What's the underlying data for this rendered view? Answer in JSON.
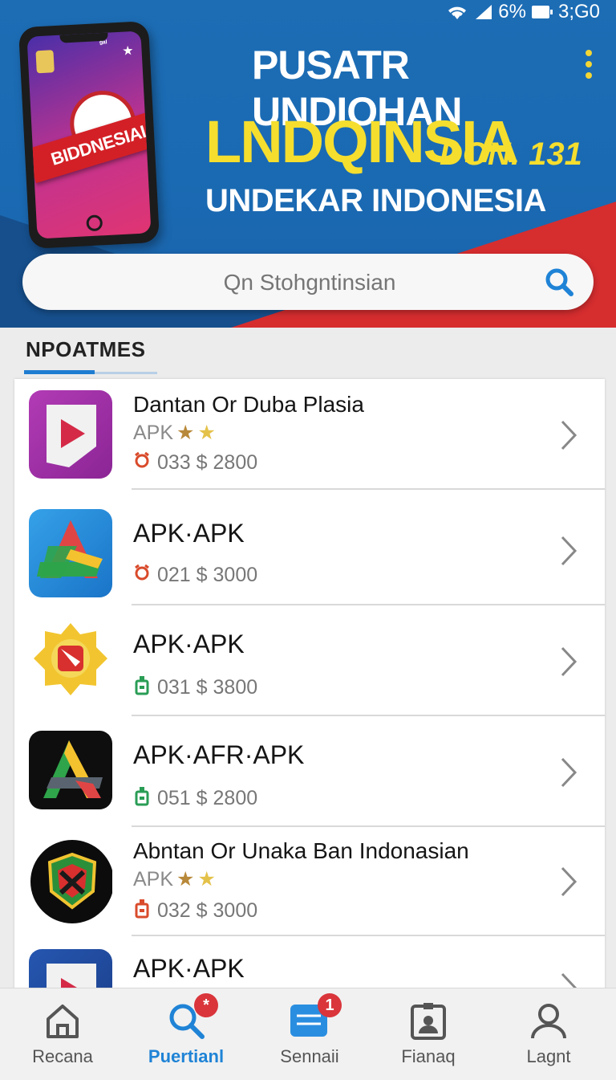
{
  "status_bar": {
    "battery": "6%",
    "time": "3;G0"
  },
  "header": {
    "phone_banner": "BIDDNESIAI",
    "phone_small": "ᵍᵃᴵ",
    "title_line1": "PUSATR UNDIOHAN",
    "title_line2": "LNDQINSIA",
    "title_line2_suffix": "DON. 131",
    "title_line3": "UNDEKAR INDONESIA"
  },
  "search": {
    "placeholder": "Qn Stohgntinsian"
  },
  "section": {
    "title": "NPOATMES"
  },
  "apps": [
    {
      "name": "Dantan Or Duba Plasia",
      "sub": "APK",
      "stars": 2,
      "price": "033 $ 2800",
      "price_icon": "alarm-icon",
      "price_color": "#d94b2b"
    },
    {
      "name": "APK·APK",
      "sub": "",
      "stars": 0,
      "price": "021 $ 3000",
      "price_icon": "alarm-icon",
      "price_color": "#d94b2b"
    },
    {
      "name": "APK·APK",
      "sub": "",
      "stars": 0,
      "price": "031 $ 3800",
      "price_icon": "bottle-icon",
      "price_color": "#2a9d55"
    },
    {
      "name": "APK·AFR·APK",
      "sub": "",
      "stars": 0,
      "price": "051 $ 2800",
      "price_icon": "bottle-icon",
      "price_color": "#2a9d55"
    },
    {
      "name": "Abntan Or Unaka Ban Indonasian",
      "sub": "APK",
      "stars": 2,
      "price": "032 $ 3000",
      "price_icon": "bottle-icon",
      "price_color": "#d94b2b"
    },
    {
      "name": "APK·APK",
      "sub": "",
      "stars": 0,
      "price": "",
      "price_icon": "",
      "price_color": ""
    }
  ],
  "bottom_nav": [
    {
      "label": "Recana",
      "icon": "home-icon",
      "active": false
    },
    {
      "label": "Puertianl",
      "icon": "search-icon",
      "active": true,
      "badge": "*"
    },
    {
      "label": "Sennaii",
      "icon": "menu-icon",
      "active": false,
      "badge": "1"
    },
    {
      "label": "Fianaq",
      "icon": "id-badge-icon",
      "active": false
    },
    {
      "label": "Lagnt",
      "icon": "user-icon",
      "active": false
    }
  ],
  "colors": {
    "accent": "#1f83d6",
    "header_blue": "#1a6ab3",
    "header_red": "#d62d2f",
    "title_yellow": "#f5de2e",
    "badge_red": "#d9353b"
  }
}
